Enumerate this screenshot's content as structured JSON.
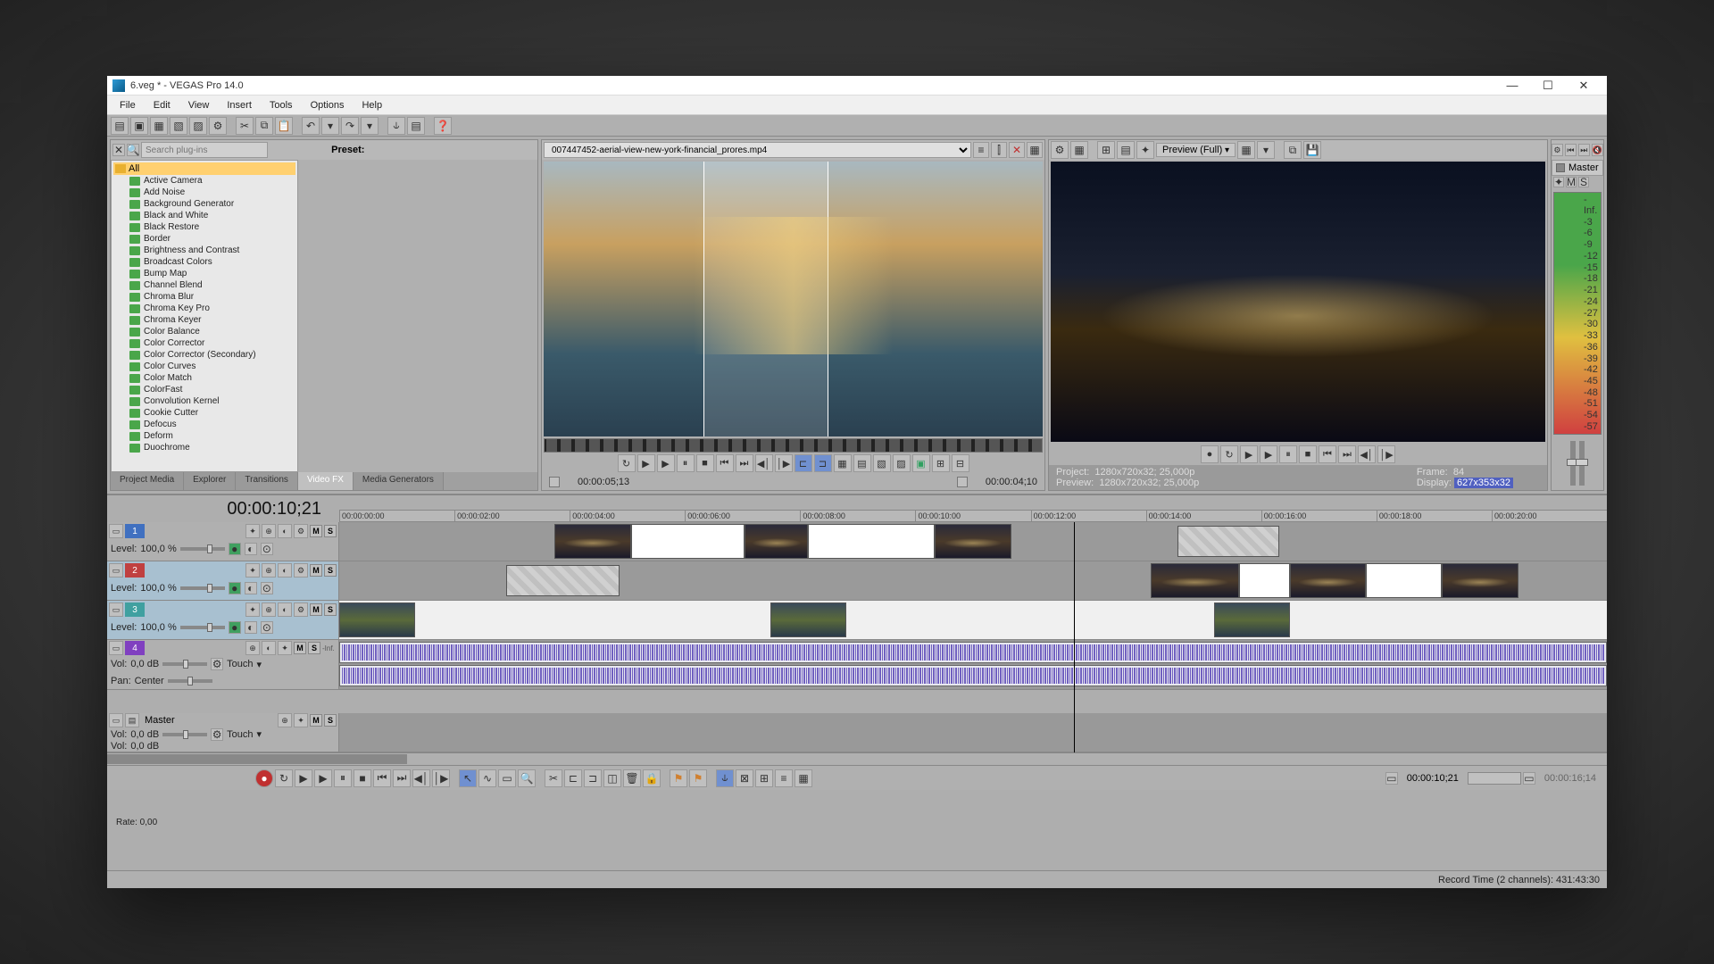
{
  "title": "6.veg * - VEGAS Pro 14.0",
  "menu": [
    "File",
    "Edit",
    "View",
    "Insert",
    "Tools",
    "Options",
    "Help"
  ],
  "search_placeholder": "Search plug-ins",
  "preset_label": "Preset:",
  "fx_root": "All",
  "fx_items": [
    "Active Camera",
    "Add Noise",
    "Background Generator",
    "Black and White",
    "Black Restore",
    "Border",
    "Brightness and Contrast",
    "Broadcast Colors",
    "Bump Map",
    "Channel Blend",
    "Chroma Blur",
    "Chroma Key Pro",
    "Chroma Keyer",
    "Color Balance",
    "Color Corrector",
    "Color Corrector (Secondary)",
    "Color Curves",
    "Color Match",
    "ColorFast",
    "Convolution Kernel",
    "Cookie Cutter",
    "Defocus",
    "Deform",
    "Duochrome"
  ],
  "dock_tabs": [
    "Project Media",
    "Explorer",
    "Transitions",
    "Video FX",
    "Media Generators"
  ],
  "dock_active": 3,
  "trimmer_file": "007447452-aerial-view-new-york-financial_prores.mp4",
  "trimmer_tc1": "00:00:05;13",
  "trimmer_tc2": "00:00:04;10",
  "preview_mode": "Preview (Full)",
  "preview_info": {
    "project_label": "Project:",
    "project_val": "1280x720x32; 25,000p",
    "preview_label": "Preview:",
    "preview_val": "1280x720x32; 25,000p",
    "frame_label": "Frame:",
    "frame_val": "84",
    "display_label": "Display:",
    "display_val": "627x353x32"
  },
  "master_label": "Master",
  "meter_scale": [
    "-Inf.",
    "-3",
    "-6",
    "-9",
    "-12",
    "-15",
    "-18",
    "-21",
    "-24",
    "-27",
    "-30",
    "-33",
    "-36",
    "-39",
    "-42",
    "-45",
    "-48",
    "-51",
    "-54",
    "-57"
  ],
  "timeline_tc": "00:00:10;21",
  "ruler": [
    "00:00:00:00",
    "00:00:02:00",
    "00:00:04:00",
    "00:00:06:00",
    "00:00:08:00",
    "00:00:10:00",
    "00:00:12:00",
    "00:00:14:00",
    "00:00:16:00",
    "00:00:18:00",
    "00:00:20:00"
  ],
  "tracks": {
    "video": {
      "level_label": "Level:",
      "level_val": "100,0 %"
    },
    "audio": {
      "vol_label": "Vol:",
      "vol_val": "0,0 dB",
      "pan_label": "Pan:",
      "pan_val": "Center",
      "touch": "Touch"
    },
    "bus": {
      "name": "Master",
      "vol_label": "Vol:",
      "vol_val": "0,0 dB",
      "touch": "Touch"
    }
  },
  "ms": {
    "m": "M",
    "s": "S"
  },
  "rate": "Rate: 0,00",
  "bottom_tc1": "00:00:10;21",
  "bottom_tc2": "00:00:16;14",
  "status": "Record Time (2 channels): 431:43:30"
}
